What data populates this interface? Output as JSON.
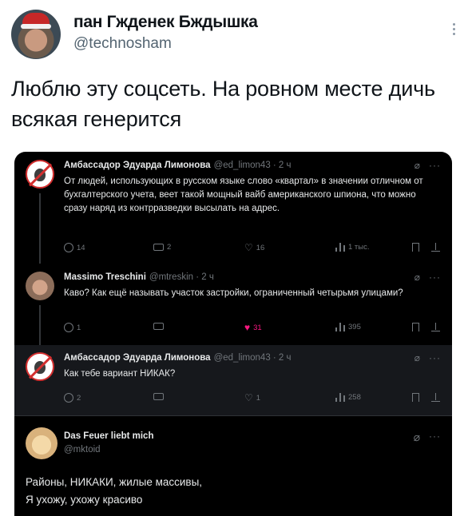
{
  "post": {
    "author_name": "пан Гжденек Бждышка",
    "author_handle": "@technosham",
    "text": "Люблю эту соцсеть. На ровном месте дичь всякая генерится"
  },
  "screenshot": {
    "tweets": [
      {
        "name": "Амбассадор Эдуарда Лимонова",
        "handle": "@ed_limon43 · 2 ч",
        "avatar_icon": "grenade-prohibited-icon",
        "text": "От людей, использующих в русском языке слово «квартал» в значении отличном от бухгалтерского учета, веет такой мощный вайб американского шпиона, что можно сразу наряд из контрразведки высылать на адрес.",
        "replies": "14",
        "reposts": "2",
        "likes": "16",
        "views": "1 тыс.",
        "liked": false
      },
      {
        "name": "Massimo Treschini",
        "handle": "@mtreskin · 2 ч",
        "avatar_icon": "man-photo-avatar",
        "text": "Каво? Как ещё называть участок застройки, ограниченный четырьмя улицами?",
        "replies": "1",
        "reposts": "",
        "likes": "31",
        "views": "395",
        "liked": true
      },
      {
        "name": "Амбассадор Эдуарда Лимонова",
        "handle": "@ed_limon43 · 2 ч",
        "avatar_icon": "grenade-prohibited-icon",
        "text": "Как тебе вариант НИКАК?",
        "replies": "2",
        "reposts": "",
        "likes": "1",
        "views": "258",
        "liked": false
      },
      {
        "name": "Das Feuer liebt mich",
        "handle": "@mktoid",
        "avatar_icon": "bear-avatar",
        "text_line1": "Районы, НИКАКИ, жилые массивы,",
        "text_line2": "Я ухожу, ухожу красиво"
      }
    ],
    "grok_icon": "⌀",
    "more_icon": "···"
  },
  "colors": {
    "like_active": "#f91880",
    "muted": "#71767b",
    "dark_bg": "#000000"
  }
}
